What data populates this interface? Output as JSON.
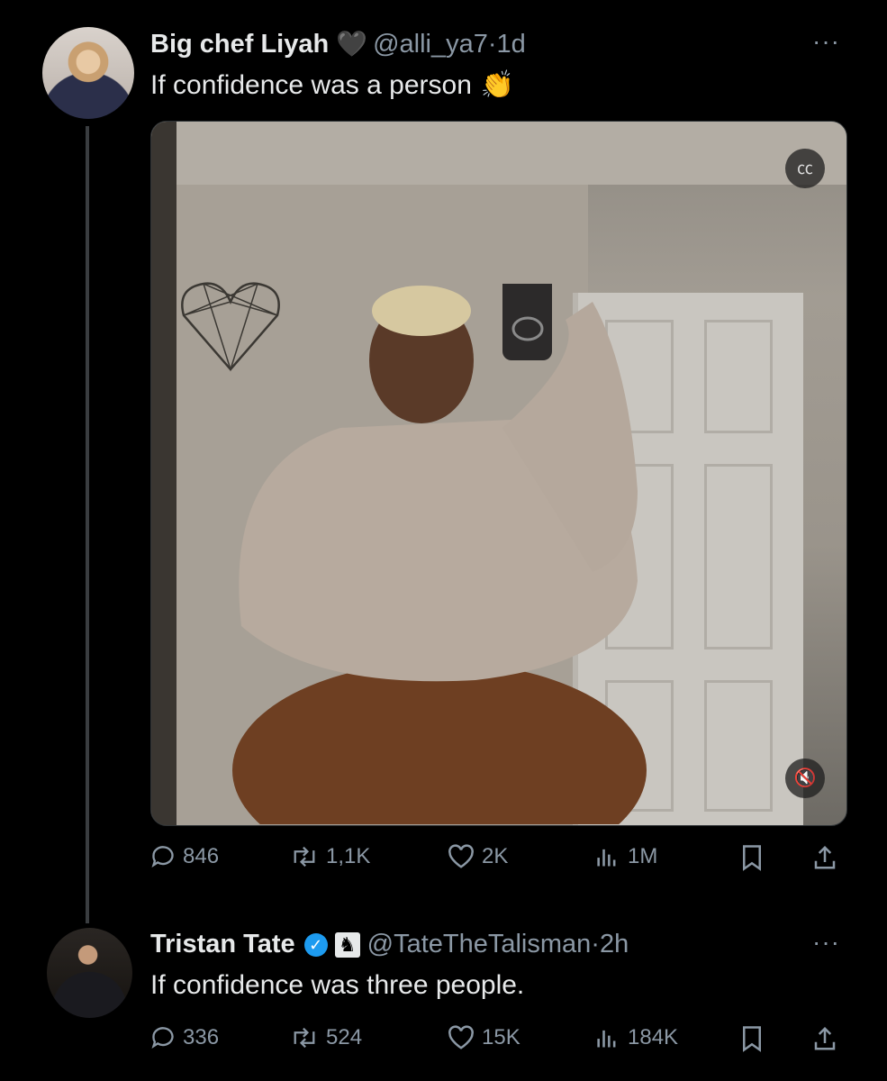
{
  "tweet1": {
    "name": "Big chef Liyah",
    "emoji": "🖤",
    "handle": "@alli_ya7",
    "sep": "·",
    "time": "1d",
    "text": "If confidence was a person",
    "text_emoji": "👏",
    "more": "···",
    "media": {
      "cc_icon": "cc-icon",
      "mute_icon": "mute-icon"
    },
    "stats": {
      "replies": "846",
      "retweets": "1,1K",
      "likes": "2K",
      "views": "1M"
    }
  },
  "tweet2": {
    "name": "Tristan Tate",
    "handle": "@TateTheTalisman",
    "sep": "·",
    "time": "2h",
    "text": "If confidence was three people.",
    "more": "···",
    "stats": {
      "replies": "336",
      "retweets": "524",
      "likes": "15K",
      "views": "184K"
    }
  },
  "colors": {
    "bg": "#000000",
    "text": "#e7e9ea",
    "muted": "#8b98a5",
    "verified": "#1d9bf0"
  }
}
